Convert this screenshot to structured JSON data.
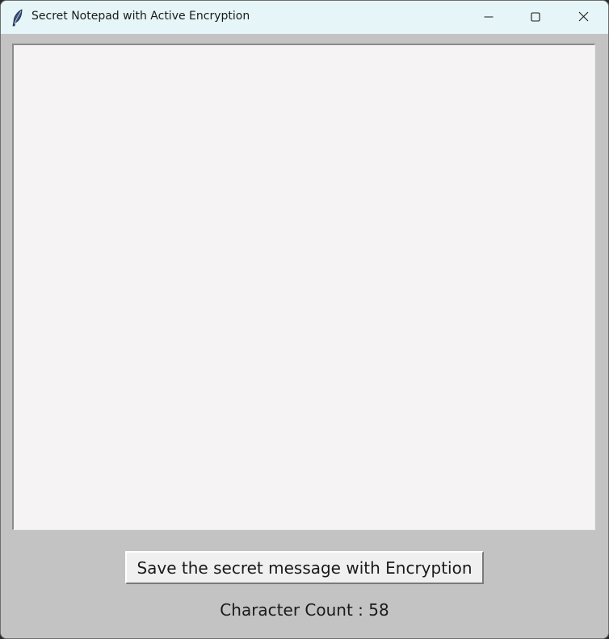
{
  "window": {
    "title": "Secret Notepad with Active Encryption",
    "app_icon": "feather-icon",
    "controls": {
      "minimize_icon": "minimize-icon",
      "maximize_icon": "maximize-icon",
      "close_icon": "close-icon"
    }
  },
  "editor": {
    "value": ""
  },
  "actions": {
    "save_label": "Save the secret message with Encryption"
  },
  "status": {
    "char_count_text": "Character Count : 58"
  },
  "colors": {
    "titlebar_bg": "#e6f5f7",
    "window_bg": "#c3c3c3",
    "editor_bg": "#f5f3f4",
    "button_bg": "#f0f0f0",
    "text": "#1a1a1a"
  }
}
